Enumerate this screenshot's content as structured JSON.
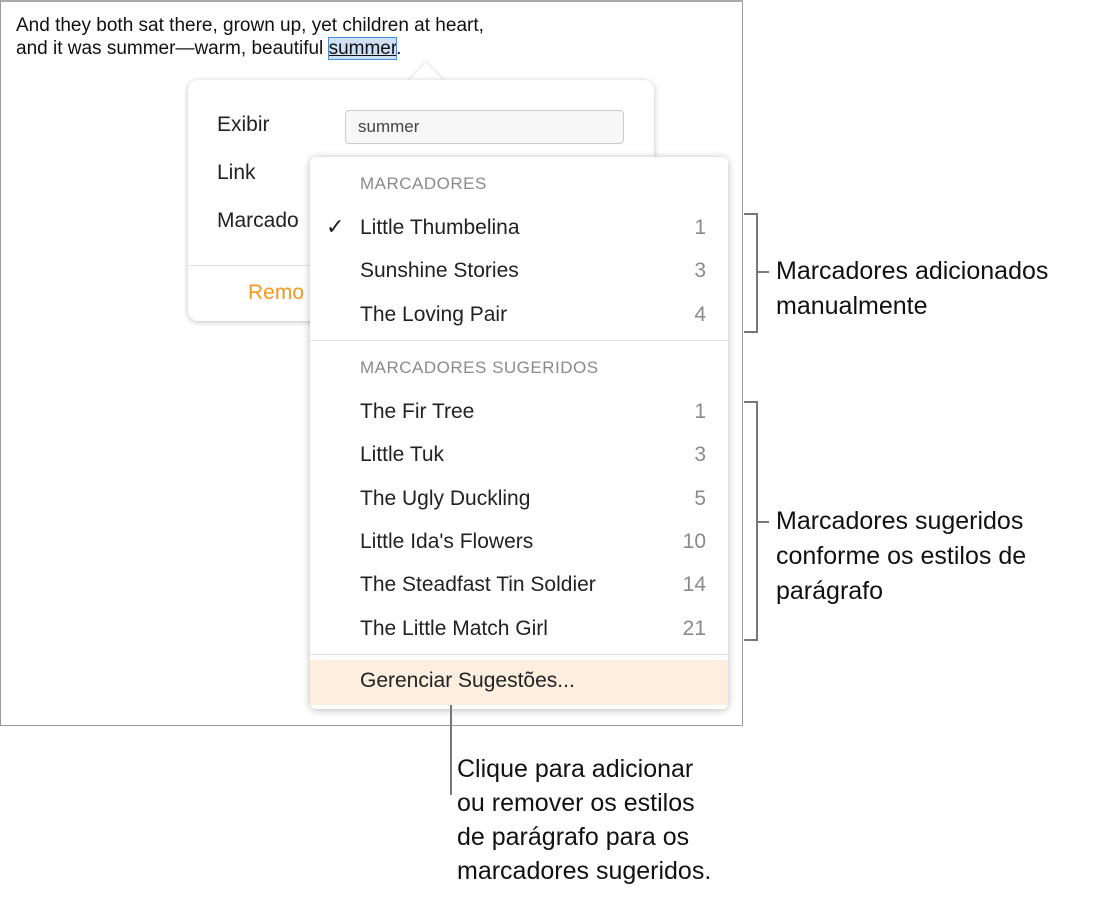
{
  "document": {
    "line1": "And they both sat there, grown up, yet children at heart,",
    "line2_before": "and it was summer—warm, beautiful ",
    "selected_word": "summer",
    "line2_after": "."
  },
  "popover": {
    "display_label": "Exibir",
    "display_value": "summer",
    "link_label": "Link",
    "bookmark_label": "Marcado",
    "remove_label": "Remo"
  },
  "menu": {
    "bookmarks_header": "MARCADORES",
    "bookmarks": [
      {
        "label": "Little Thumbelina",
        "page": "1",
        "checked": true
      },
      {
        "label": "Sunshine Stories",
        "page": "3"
      },
      {
        "label": "The Loving Pair",
        "page": "4"
      }
    ],
    "suggested_header": "MARCADORES SUGERIDOS",
    "suggested": [
      {
        "label": "The Fir Tree",
        "page": "1"
      },
      {
        "label": "Little Tuk",
        "page": "3"
      },
      {
        "label": "The Ugly Duckling",
        "page": "5"
      },
      {
        "label": "Little Ida's Flowers",
        "page": "10"
      },
      {
        "label": "The Steadfast Tin Soldier",
        "page": "14"
      },
      {
        "label": "The Little Match Girl",
        "page": "21"
      }
    ],
    "manage_label": "Gerenciar Sugestões...",
    "check_icon": "✓"
  },
  "annotations": {
    "manual": [
      "Marcadores adicionados",
      "manualmente"
    ],
    "suggested": [
      "Marcadores sugeridos",
      "conforme os estilos de",
      "parágrafo"
    ],
    "manage": [
      "Clique para adicionar",
      "ou remover os estilos",
      "de parágrafo para os",
      "marcadores sugeridos."
    ]
  },
  "colors": {
    "accent": "#f7971e",
    "highlight": "#fdeee0",
    "selection": "#3a8ee6"
  }
}
